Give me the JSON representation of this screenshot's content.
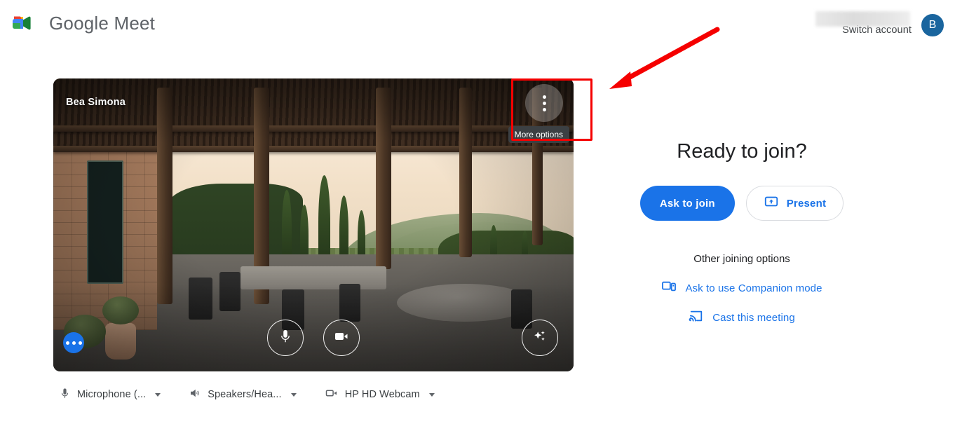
{
  "header": {
    "logo_icon": "google-meet-logo-icon",
    "product_name": "Google Meet",
    "redacted_email_bar": "",
    "switch_account_label": "Switch account",
    "avatar_initial": "B"
  },
  "preview": {
    "participant_name": "Bea Simona",
    "more_options": {
      "icon": "more-vert-icon",
      "tooltip": "More options"
    },
    "controls": [
      {
        "name": "microphone-toggle",
        "icon": "microphone-icon"
      },
      {
        "name": "camera-toggle",
        "icon": "video-camera-icon"
      },
      {
        "name": "visual-effects",
        "icon": "sparkles-icon"
      }
    ],
    "more_actions_icon": "more-horiz-icon",
    "background_description": "Tuscan pergola terrace at sunset"
  },
  "devices": [
    {
      "icon": "microphone-icon",
      "label": "Microphone (...",
      "caret": "chevron-down-icon"
    },
    {
      "icon": "speaker-icon",
      "label": "Speakers/Hea...",
      "caret": "chevron-down-icon"
    },
    {
      "icon": "video-camera-icon",
      "label": "HP HD Webcam",
      "caret": "chevron-down-icon"
    }
  ],
  "right_panel": {
    "title": "Ready to join?",
    "ask_to_join_label": "Ask to join",
    "present_label": "Present",
    "present_icon": "present-screen-icon",
    "other_options_title": "Other joining options",
    "companion_mode_label": "Ask to use Companion mode",
    "companion_mode_icon": "companion-mode-icon",
    "cast_label": "Cast this meeting",
    "cast_icon": "cast-icon"
  },
  "annotations": {
    "highlight_box_color": "#f50000",
    "arrow_color": "#f50000",
    "highlight_target": "more-options-button"
  },
  "colors": {
    "accent_blue": "#1a73e8",
    "text_primary": "#202124",
    "text_secondary": "#3c4043",
    "avatar_bg": "#1a659e",
    "annotation_red": "#f50000"
  }
}
